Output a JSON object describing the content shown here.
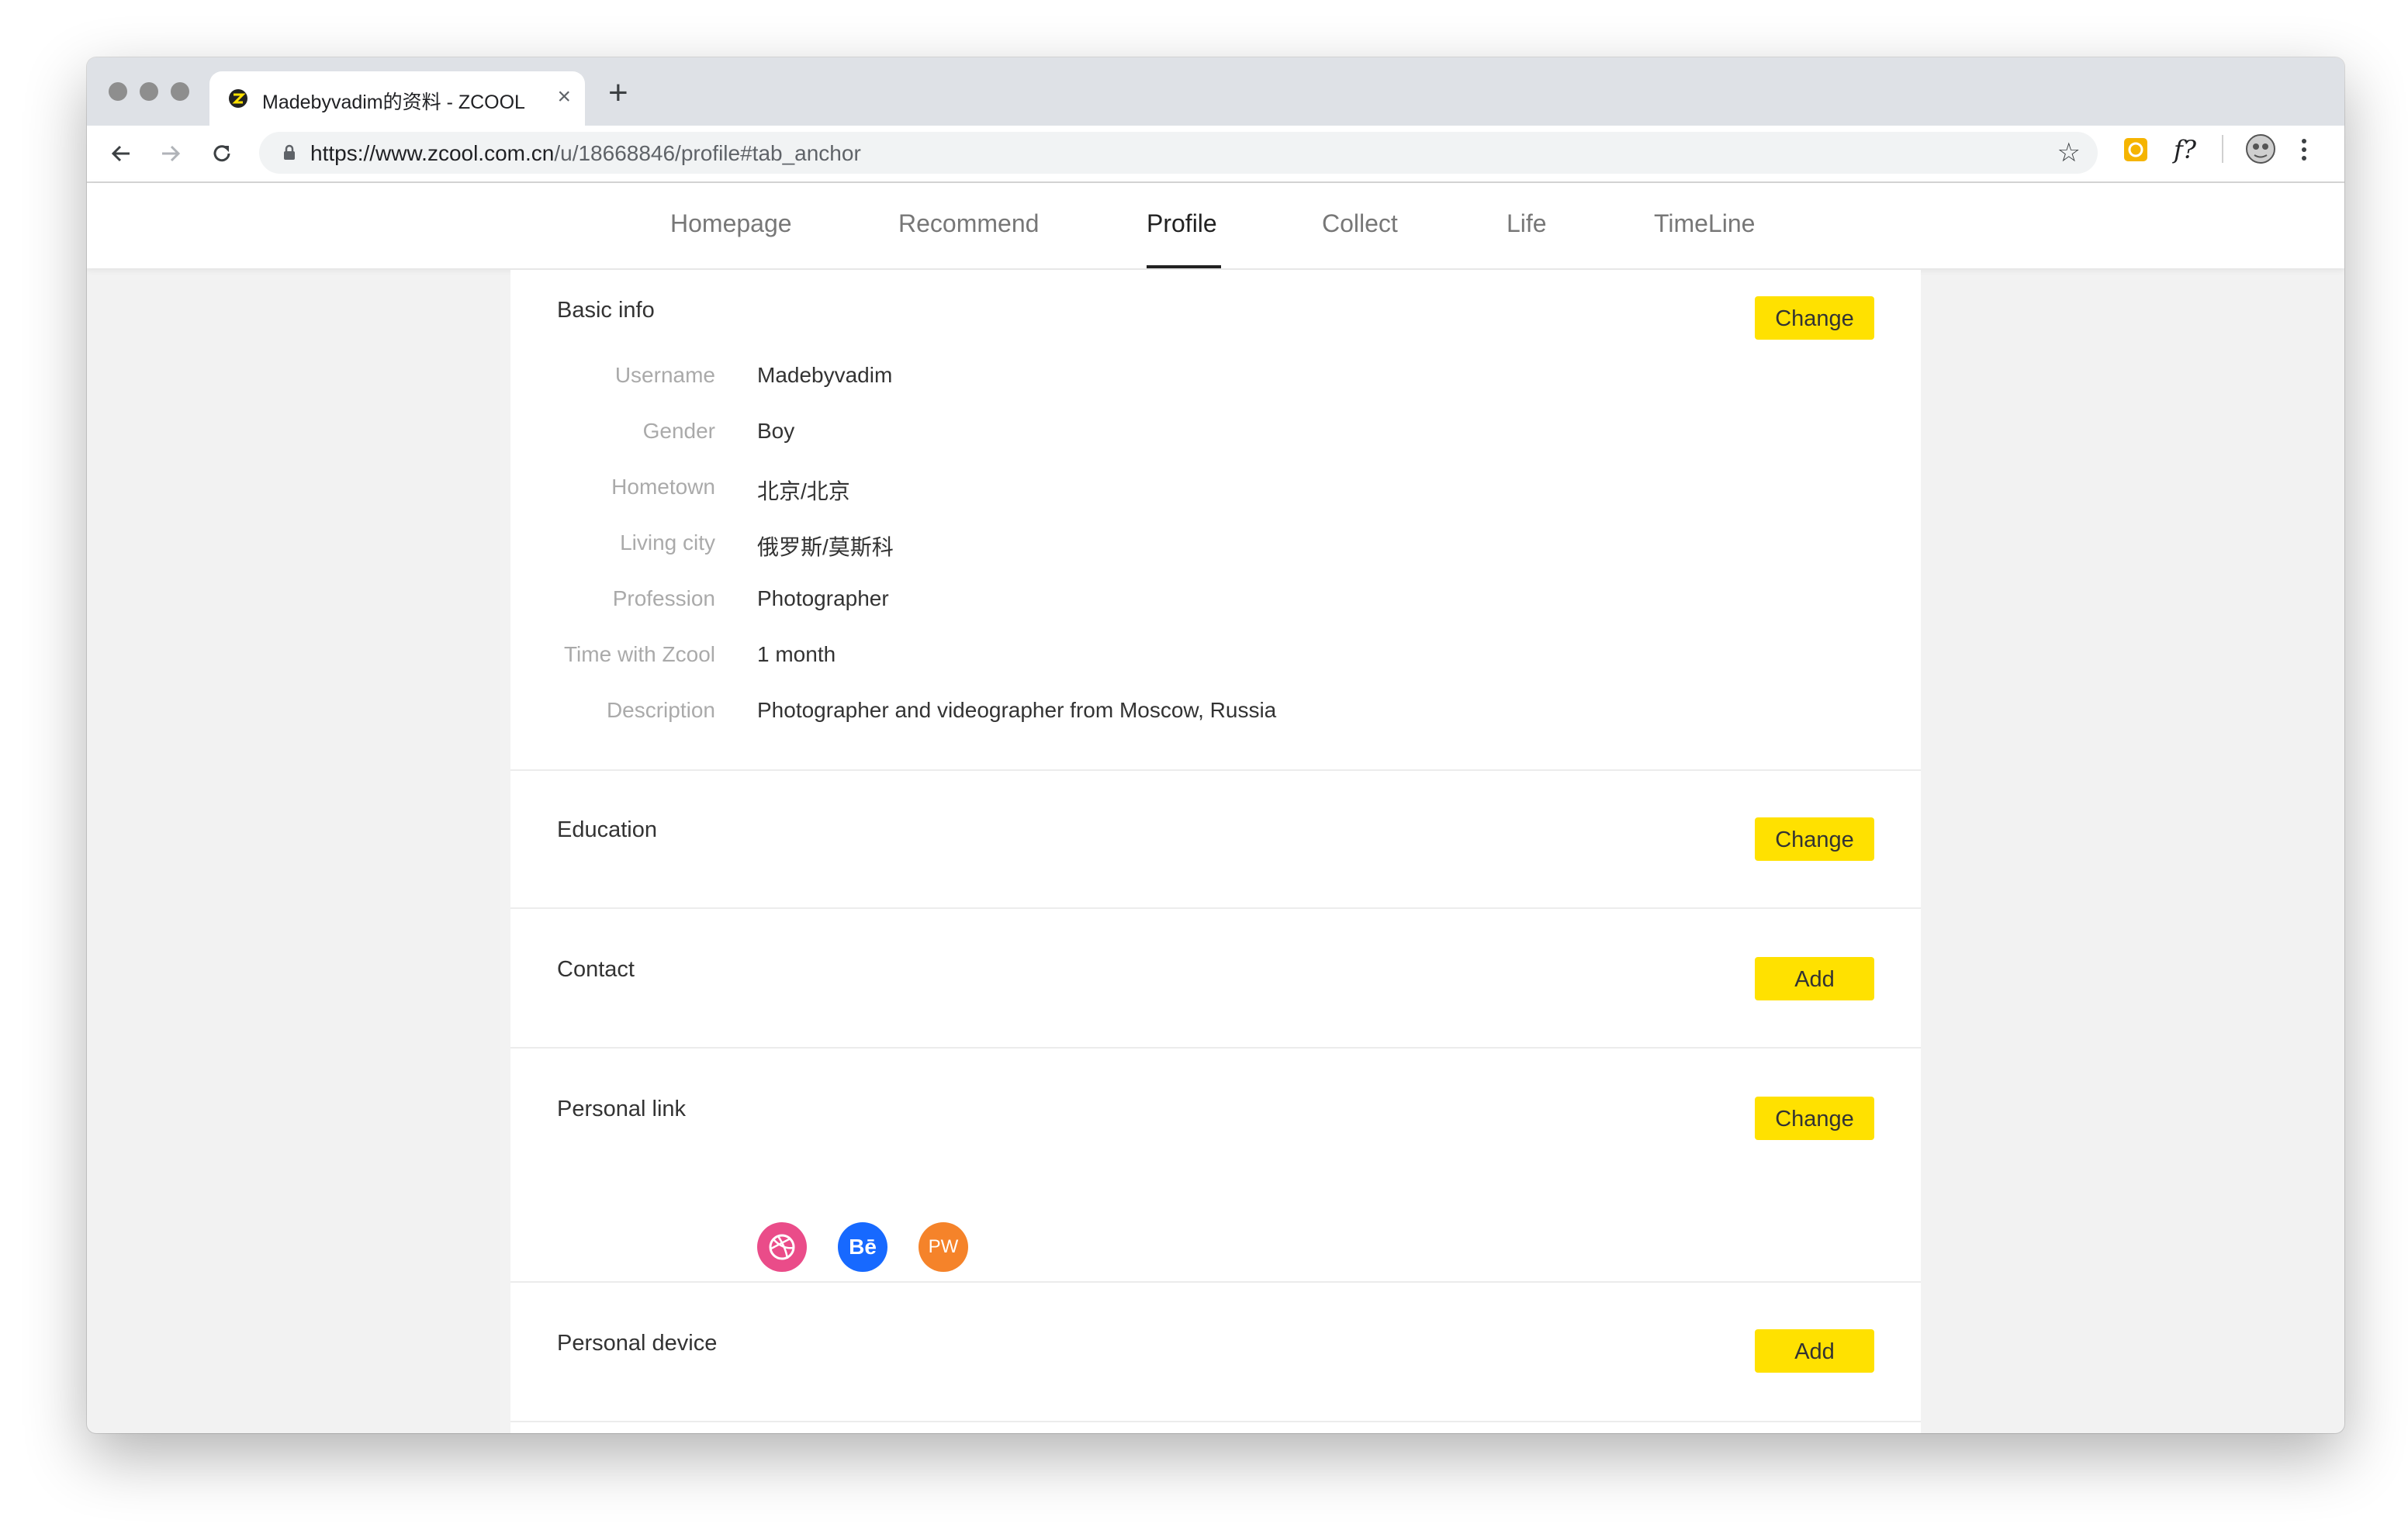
{
  "browser": {
    "tab_title": "Madebyvadim的资料 - ZCOOL",
    "url_host": "https://www.zcool.com.cn",
    "url_path": "/u/18668846/profile#tab_anchor",
    "ext_label": "f?"
  },
  "nav": {
    "items": [
      {
        "label": "Homepage"
      },
      {
        "label": "Recommend"
      },
      {
        "label": "Profile"
      },
      {
        "label": "Collect"
      },
      {
        "label": "Life"
      },
      {
        "label": "TimeLine"
      }
    ],
    "active": "Profile"
  },
  "basic_info": {
    "title": "Basic info",
    "button": "Change",
    "rows": [
      {
        "label": "Username",
        "value": "Madebyvadim"
      },
      {
        "label": "Gender",
        "value": "Boy"
      },
      {
        "label": "Hometown",
        "value": "北京/北京"
      },
      {
        "label": "Living city",
        "value": "俄罗斯/莫斯科"
      },
      {
        "label": "Profession",
        "value": "Photographer"
      },
      {
        "label": "Time with Zcool",
        "value": "1 month"
      },
      {
        "label": "Description",
        "value": "Photographer and videographer from Moscow, Russia"
      }
    ]
  },
  "education": {
    "title": "Education",
    "button": "Change"
  },
  "contact": {
    "title": "Contact",
    "button": "Add"
  },
  "personal_link": {
    "title": "Personal link",
    "button": "Change",
    "links": [
      {
        "icon": "dribbble-icon",
        "color": "#ea4c89"
      },
      {
        "icon": "behance-icon",
        "label": "Bē",
        "color": "#1769ff"
      },
      {
        "icon": "pw-icon",
        "label": "PW",
        "color": "#f5832a"
      }
    ]
  },
  "personal_device": {
    "title": "Personal device",
    "button": "Add"
  },
  "colors": {
    "accent_button": "#ffe100",
    "active_nav": "#222222"
  }
}
